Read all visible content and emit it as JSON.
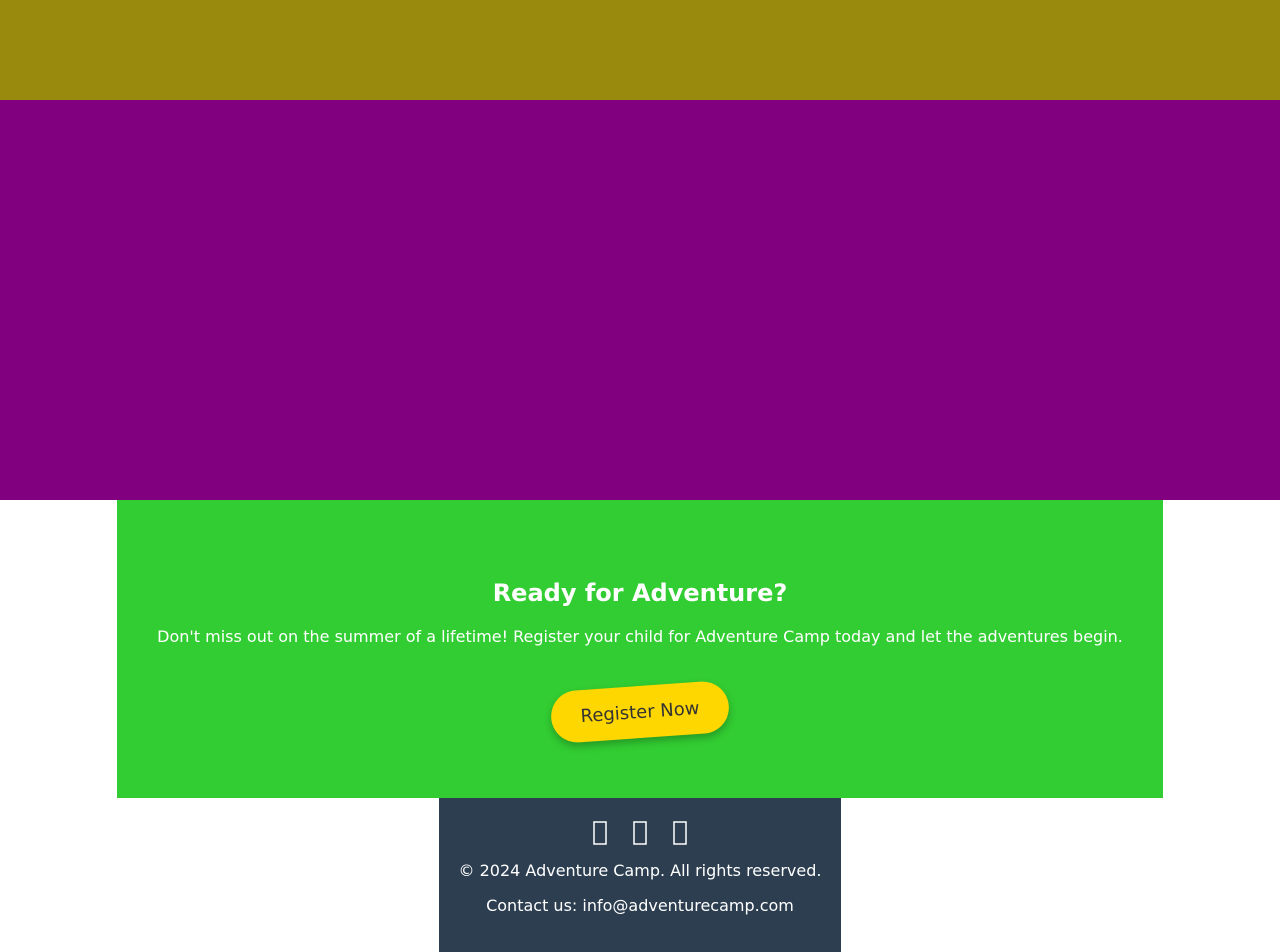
{
  "colors": {
    "top_bar": "#998a0e",
    "hero": "#800080",
    "cta_background": "#32cd32",
    "button_background": "#ffd700",
    "button_text": "#333333",
    "footer_background": "#2c3e50",
    "text_light": "#ffffff"
  },
  "cta": {
    "title": "Ready for Adventure?",
    "text": "Don't miss out on the summer of a lifetime! Register your child for Adventure Camp today and let the adventures begin.",
    "button_label": "Register Now"
  },
  "footer": {
    "social_icons": [
      "facebook-icon",
      "instagram-icon",
      "twitter-icon"
    ],
    "copyright": "© 2024 Adventure Camp. All rights reserved.",
    "contact": "Contact us: info@adventurecamp.com"
  }
}
